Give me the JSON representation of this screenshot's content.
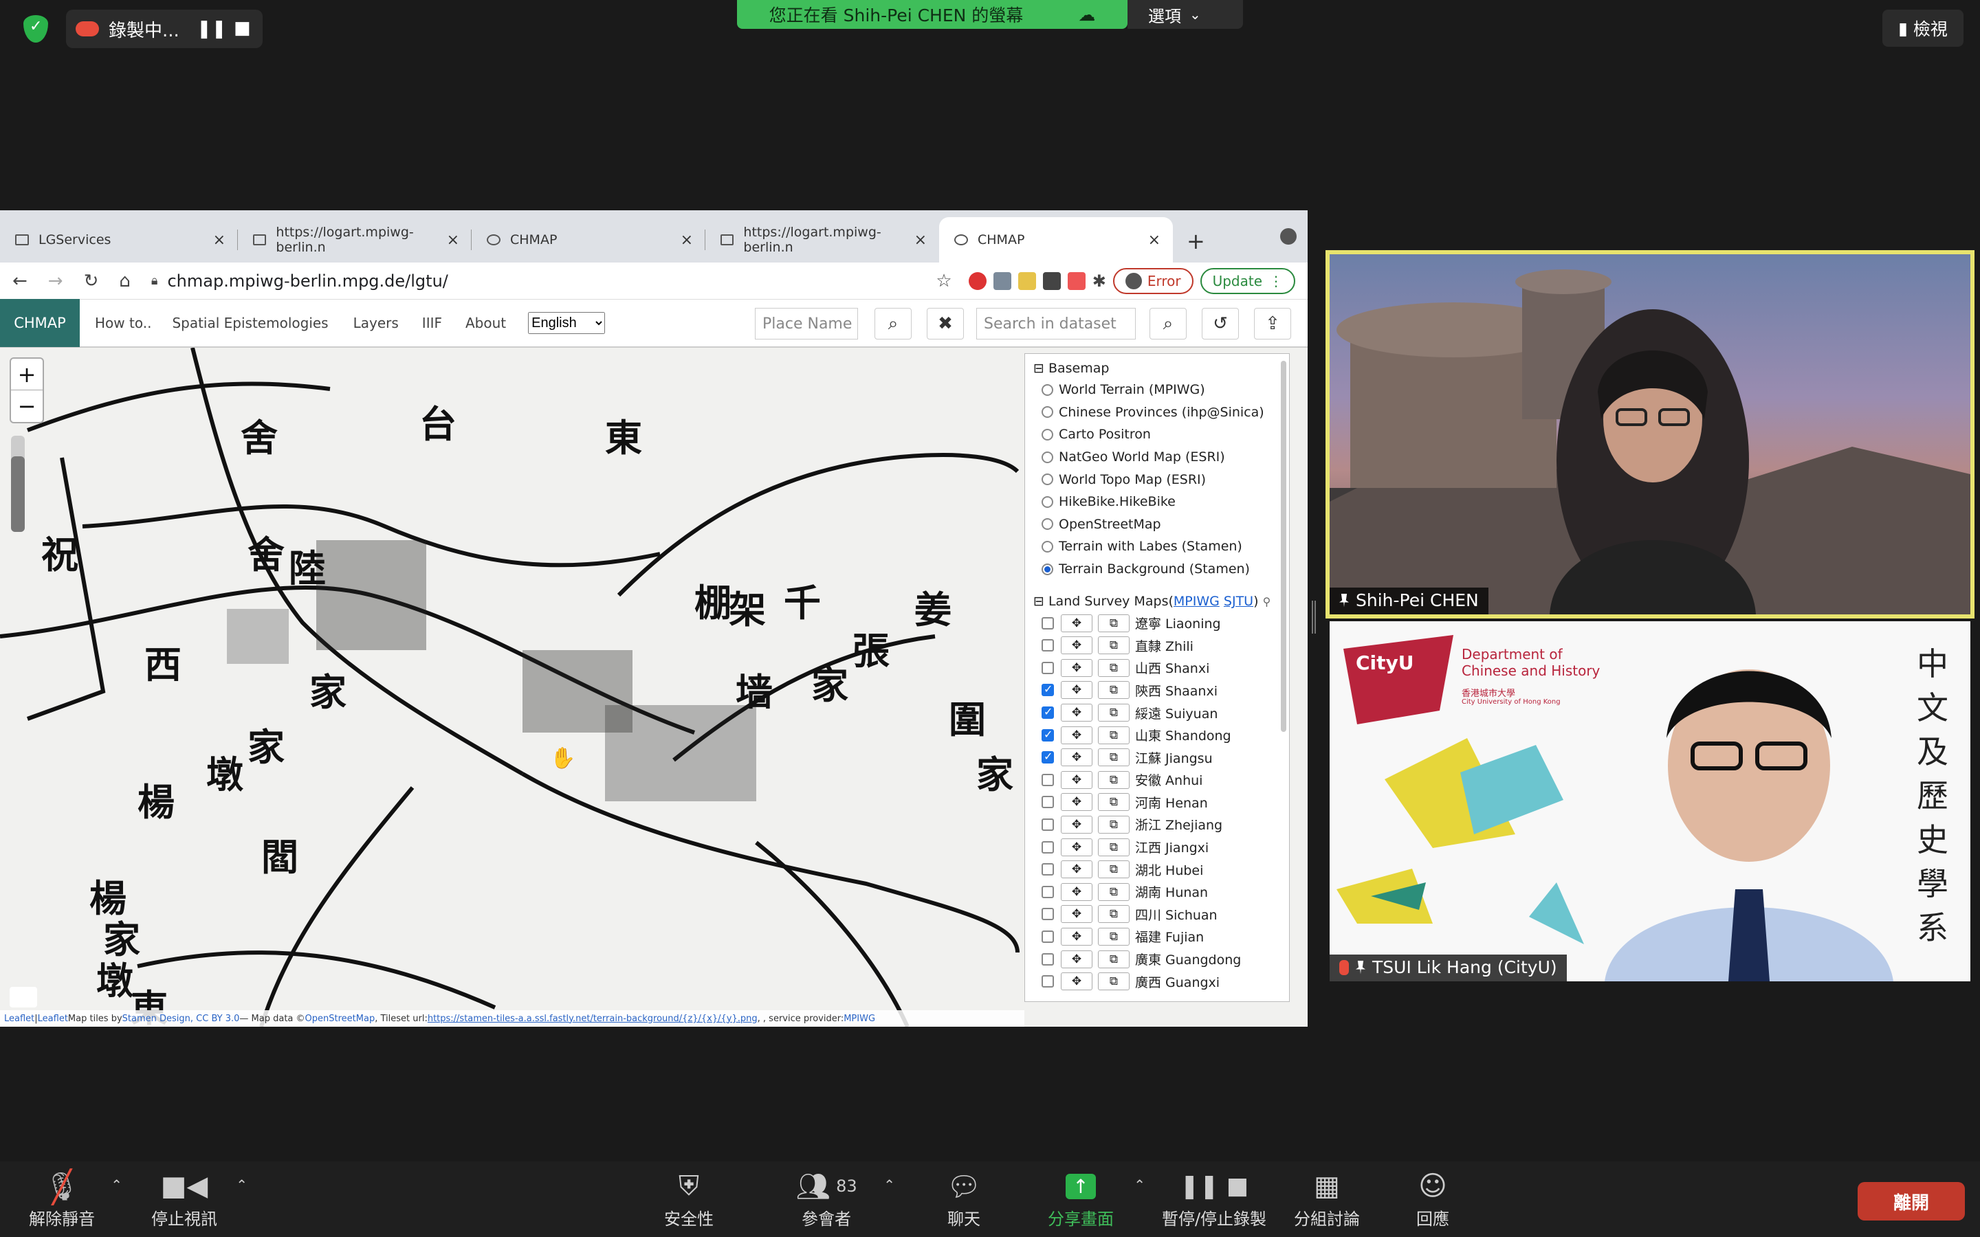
{
  "zoom_top": {
    "recording_label": "錄製中...",
    "sharing_banner": "您正在看 Shih-Pei CHEN 的螢幕",
    "options_label": "選項",
    "view_label": "檢視"
  },
  "browser": {
    "tabs": [
      {
        "title": "LGServices"
      },
      {
        "title": "https://logart.mpiwg-berlin.n"
      },
      {
        "title": "CHMAP"
      },
      {
        "title": "https://logart.mpiwg-berlin.n"
      },
      {
        "title": "CHMAP"
      }
    ],
    "url": "chmap.mpiwg-berlin.mpg.de/lgtu/",
    "error_label": "Error",
    "update_label": "Update"
  },
  "app": {
    "brand": "CHMAP",
    "menu": [
      "How to..",
      "Spatial Epistemologies",
      "Layers",
      "IIIF",
      "About"
    ],
    "language": "English",
    "place_placeholder": "Place Name",
    "dataset_placeholder": "Search in dataset"
  },
  "panel": {
    "basemap_title": "Basemap",
    "basemaps": [
      {
        "label": "World Terrain (MPIWG)",
        "selected": false
      },
      {
        "label": "Chinese Provinces (ihp@Sinica)",
        "selected": false
      },
      {
        "label": "Carto Positron",
        "selected": false
      },
      {
        "label": "NatGeo World Map (ESRI)",
        "selected": false
      },
      {
        "label": "World Topo Map (ESRI)",
        "selected": false
      },
      {
        "label": "HikeBike.HikeBike",
        "selected": false
      },
      {
        "label": "OpenStreetMap",
        "selected": false
      },
      {
        "label": "Terrain with Labes (Stamen)",
        "selected": false
      },
      {
        "label": "Terrain Background (Stamen)",
        "selected": true
      }
    ],
    "land_title": "Land Survey Maps(",
    "land_link1": "MPIWG",
    "land_link2": "SJTU",
    "land_close": ")",
    "provinces": [
      {
        "label": "遼寧 Liaoning",
        "checked": false
      },
      {
        "label": "直隸 Zhili",
        "checked": false
      },
      {
        "label": "山西 Shanxi",
        "checked": false
      },
      {
        "label": "陝西 Shaanxi",
        "checked": true
      },
      {
        "label": "綏遠 Suiyuan",
        "checked": true
      },
      {
        "label": "山東 Shandong",
        "checked": true
      },
      {
        "label": "江蘇 Jiangsu",
        "checked": true
      },
      {
        "label": "安徽 Anhui",
        "checked": false
      },
      {
        "label": "河南 Henan",
        "checked": false
      },
      {
        "label": "浙江 Zhejiang",
        "checked": false
      },
      {
        "label": "江西 Jiangxi",
        "checked": false
      },
      {
        "label": "湖北 Hubei",
        "checked": false
      },
      {
        "label": "湖南 Hunan",
        "checked": false
      },
      {
        "label": "四川 Sichuan",
        "checked": false
      },
      {
        "label": "福建 Fujian",
        "checked": false
      },
      {
        "label": "廣東 Guangdong",
        "checked": false
      },
      {
        "label": "廣西 Guangxi",
        "checked": false
      }
    ]
  },
  "attribution": {
    "leaflet": "Leaflet",
    "sep": " | ",
    "leaflet2": "Leaflet",
    "tiles_by": " Map tiles by ",
    "stamen": "Stamen Design, CC BY 3.0",
    "mapdata": " — Map data © ",
    "osm": "OpenStreetMap",
    "tileset": ", Tileset url:",
    "tileset_url": "https://stamen-tiles-a.a.ssl.fastly.net/terrain-background/{z}/{x}/{y}.png",
    "provider": ", , service provider: ",
    "mpiwg": "MPIWG"
  },
  "video": {
    "p1_name": "Shih-Pei CHEN",
    "p2_name": "TSUI Lik Hang (CityU)",
    "cityu_logo": "CityU",
    "cityu_dept": "Department of Chinese and History",
    "cityu_cn": "香港城市大學",
    "cityu_en": "City University of Hong Kong",
    "calligraphy": "中文及歷史學系"
  },
  "toolbar": {
    "unmute": "解除靜音",
    "stop_video": "停止視訊",
    "security": "安全性",
    "participants": "參會者",
    "participant_count": "83",
    "chat": "聊天",
    "share": "分享畫面",
    "pause_record": "暫停/停止錄製",
    "breakout": "分組討論",
    "reactions": "回應",
    "leave": "離開"
  },
  "map_labels": [
    "舍",
    "台",
    "東",
    "棚",
    "架",
    "千",
    "墙",
    "家",
    "張",
    "姜",
    "舍",
    "陸",
    "祝",
    "西",
    "家",
    "楊",
    "墩",
    "家",
    "閻",
    "楊",
    "家",
    "墩",
    "東",
    "圍",
    "家"
  ],
  "colors": {
    "accent_green": "#3fbe5a",
    "brand": "#2b6f6a",
    "leave_red": "#c0392b",
    "highlight_border": "#e7e36e"
  }
}
